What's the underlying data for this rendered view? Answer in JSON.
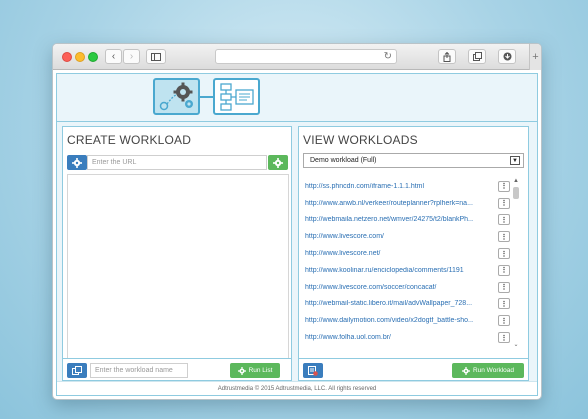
{
  "browser": {
    "toolbar_buttons": [
      "chevron-left-icon",
      "chevron-right-icon",
      "sidebar-icon",
      "share-icon",
      "tabs-icon",
      "download-icon"
    ],
    "new_tab_label": "+"
  },
  "create_panel": {
    "title": "CREATE WORKLOAD",
    "url_placeholder": "Enter the URL",
    "workload_name_placeholder": "Enter the workload name",
    "run_list_label": "Run List"
  },
  "view_panel": {
    "title": "VIEW WORKLOADS",
    "selected_workload": "Demo workload (Full)",
    "urls": [
      "http://ss.phncdn.com/iframe-1.1.1.html",
      "http://www.anwb.nl/verkeer/routeplanner?rplherk=na...",
      "http://webmaila.netzero.net/wmver/24275/t2/blankPh...",
      "http://www.livescore.com/",
      "http://www.livescore.net/",
      "http://www.koolinar.ru/enciclopedia/comments/1191",
      "http://www.livescore.com/soccer/concacaf/",
      "http://webmail-static.libero.it/mail/advWallpaper_728...",
      "http://www.dailymotion.com/video/x2dogtf_battle-sho...",
      "http://www.folha.uol.com.br/"
    ],
    "run_workload_label": "Run Workload"
  },
  "footer": {
    "copyright": "Adtrustmedia © 2015 Adtrustmedia, LLC. All rights reserved"
  }
}
